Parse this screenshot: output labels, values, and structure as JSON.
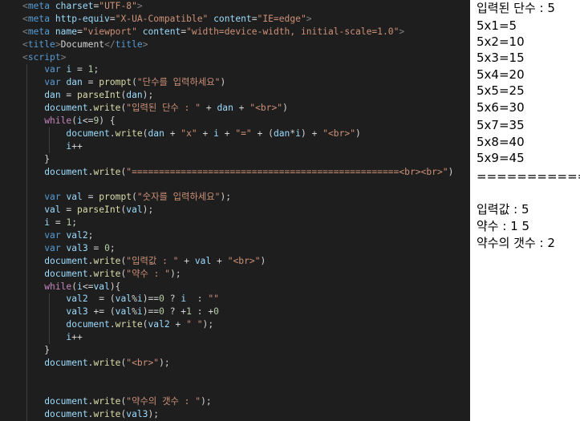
{
  "editor": {
    "theme": {
      "background": "#1e1e1e",
      "tag": "#569cd6",
      "attr": "#9cdcfe",
      "string": "#ce9178",
      "keyword": "#569cd6",
      "control": "#c586c0",
      "function": "#dcdcaa",
      "number": "#b5cea8"
    },
    "lines": [
      [
        {
          "t": "<",
          "c": "punc"
        },
        {
          "t": "meta",
          "c": "tag"
        },
        {
          "t": " "
        },
        {
          "t": "charset",
          "c": "attr"
        },
        {
          "t": "="
        },
        {
          "t": "\"UTF-8\"",
          "c": "str"
        },
        {
          "t": ">",
          "c": "punc"
        }
      ],
      [
        {
          "t": "<",
          "c": "punc"
        },
        {
          "t": "meta",
          "c": "tag"
        },
        {
          "t": " "
        },
        {
          "t": "http-equiv",
          "c": "attr"
        },
        {
          "t": "="
        },
        {
          "t": "\"X-UA-Compatible\"",
          "c": "str"
        },
        {
          "t": " "
        },
        {
          "t": "content",
          "c": "attr"
        },
        {
          "t": "="
        },
        {
          "t": "\"IE=edge\"",
          "c": "str"
        },
        {
          "t": ">",
          "c": "punc"
        }
      ],
      [
        {
          "t": "<",
          "c": "punc"
        },
        {
          "t": "meta",
          "c": "tag"
        },
        {
          "t": " "
        },
        {
          "t": "name",
          "c": "attr"
        },
        {
          "t": "="
        },
        {
          "t": "\"viewport\"",
          "c": "str"
        },
        {
          "t": " "
        },
        {
          "t": "content",
          "c": "attr"
        },
        {
          "t": "="
        },
        {
          "t": "\"width=device-width, initial-scale=1.0\"",
          "c": "str"
        },
        {
          "t": ">",
          "c": "punc"
        }
      ],
      [
        {
          "t": "<",
          "c": "punc"
        },
        {
          "t": "title",
          "c": "tag"
        },
        {
          "t": ">",
          "c": "punc"
        },
        {
          "t": "Document",
          "c": "txt"
        },
        {
          "t": "</",
          "c": "punc"
        },
        {
          "t": "title",
          "c": "tag"
        },
        {
          "t": ">",
          "c": "punc"
        }
      ],
      [
        {
          "t": "<",
          "c": "punc"
        },
        {
          "t": "script",
          "c": "tag"
        },
        {
          "t": ">",
          "c": "punc"
        }
      ],
      [
        {
          "t": "    "
        },
        {
          "t": "var",
          "c": "kw"
        },
        {
          "t": " "
        },
        {
          "t": "i",
          "c": "var"
        },
        {
          "t": " = "
        },
        {
          "t": "1",
          "c": "num"
        },
        {
          "t": ";"
        }
      ],
      [
        {
          "t": "    "
        },
        {
          "t": "var",
          "c": "kw"
        },
        {
          "t": " "
        },
        {
          "t": "dan",
          "c": "var"
        },
        {
          "t": " = "
        },
        {
          "t": "prompt",
          "c": "fn"
        },
        {
          "t": "("
        },
        {
          "t": "\"단수를 입력하세요\"",
          "c": "str"
        },
        {
          "t": ")"
        }
      ],
      [
        {
          "t": "    "
        },
        {
          "t": "dan",
          "c": "var"
        },
        {
          "t": " = "
        },
        {
          "t": "parseInt",
          "c": "fn"
        },
        {
          "t": "("
        },
        {
          "t": "dan",
          "c": "var"
        },
        {
          "t": ");"
        }
      ],
      [
        {
          "t": "    "
        },
        {
          "t": "document",
          "c": "var"
        },
        {
          "t": "."
        },
        {
          "t": "write",
          "c": "fn"
        },
        {
          "t": "("
        },
        {
          "t": "\"입력된 단수 : \"",
          "c": "str"
        },
        {
          "t": " + "
        },
        {
          "t": "dan",
          "c": "var"
        },
        {
          "t": " + "
        },
        {
          "t": "\"<br>\"",
          "c": "str"
        },
        {
          "t": ")"
        }
      ],
      [
        {
          "t": "    "
        },
        {
          "t": "while",
          "c": "ctl"
        },
        {
          "t": "("
        },
        {
          "t": "i",
          "c": "var"
        },
        {
          "t": "<="
        },
        {
          "t": "9",
          "c": "num"
        },
        {
          "t": ") {"
        }
      ],
      [
        {
          "t": "        "
        },
        {
          "t": "document",
          "c": "var"
        },
        {
          "t": "."
        },
        {
          "t": "write",
          "c": "fn"
        },
        {
          "t": "("
        },
        {
          "t": "dan",
          "c": "var"
        },
        {
          "t": " + "
        },
        {
          "t": "\"x\"",
          "c": "str"
        },
        {
          "t": " + "
        },
        {
          "t": "i",
          "c": "var"
        },
        {
          "t": " + "
        },
        {
          "t": "\"=\"",
          "c": "str"
        },
        {
          "t": " + ("
        },
        {
          "t": "dan",
          "c": "var"
        },
        {
          "t": "*"
        },
        {
          "t": "i",
          "c": "var"
        },
        {
          "t": ") + "
        },
        {
          "t": "\"<br>\"",
          "c": "str"
        },
        {
          "t": ")"
        }
      ],
      [
        {
          "t": "        "
        },
        {
          "t": "i",
          "c": "var"
        },
        {
          "t": "++"
        }
      ],
      [
        {
          "t": "    }"
        }
      ],
      [
        {
          "t": "    "
        },
        {
          "t": "document",
          "c": "var"
        },
        {
          "t": "."
        },
        {
          "t": "write",
          "c": "fn"
        },
        {
          "t": "("
        },
        {
          "t": "\"=================================================<br><br>\"",
          "c": "str"
        },
        {
          "t": ")"
        }
      ],
      [],
      [
        {
          "t": "    "
        },
        {
          "t": "var",
          "c": "kw"
        },
        {
          "t": " "
        },
        {
          "t": "val",
          "c": "var"
        },
        {
          "t": " = "
        },
        {
          "t": "prompt",
          "c": "fn"
        },
        {
          "t": "("
        },
        {
          "t": "\"숫자를 입력하세요\"",
          "c": "str"
        },
        {
          "t": ");"
        }
      ],
      [
        {
          "t": "    "
        },
        {
          "t": "val",
          "c": "var"
        },
        {
          "t": " = "
        },
        {
          "t": "parseInt",
          "c": "fn"
        },
        {
          "t": "("
        },
        {
          "t": "val",
          "c": "var"
        },
        {
          "t": ");"
        }
      ],
      [
        {
          "t": "    "
        },
        {
          "t": "i",
          "c": "var"
        },
        {
          "t": " = "
        },
        {
          "t": "1",
          "c": "num"
        },
        {
          "t": ";"
        }
      ],
      [
        {
          "t": "    "
        },
        {
          "t": "var",
          "c": "kw"
        },
        {
          "t": " "
        },
        {
          "t": "val2",
          "c": "var"
        },
        {
          "t": ";"
        }
      ],
      [
        {
          "t": "    "
        },
        {
          "t": "var",
          "c": "kw"
        },
        {
          "t": " "
        },
        {
          "t": "val3",
          "c": "var"
        },
        {
          "t": " = "
        },
        {
          "t": "0",
          "c": "num"
        },
        {
          "t": ";"
        }
      ],
      [
        {
          "t": "    "
        },
        {
          "t": "document",
          "c": "var"
        },
        {
          "t": "."
        },
        {
          "t": "write",
          "c": "fn"
        },
        {
          "t": "("
        },
        {
          "t": "\"입력값 : \"",
          "c": "str"
        },
        {
          "t": " + "
        },
        {
          "t": "val",
          "c": "var"
        },
        {
          "t": " + "
        },
        {
          "t": "\"<br>\"",
          "c": "str"
        },
        {
          "t": ")"
        }
      ],
      [
        {
          "t": "    "
        },
        {
          "t": "document",
          "c": "var"
        },
        {
          "t": "."
        },
        {
          "t": "write",
          "c": "fn"
        },
        {
          "t": "("
        },
        {
          "t": "\"약수 : \"",
          "c": "str"
        },
        {
          "t": ");"
        }
      ],
      [
        {
          "t": "    "
        },
        {
          "t": "while",
          "c": "ctl"
        },
        {
          "t": "("
        },
        {
          "t": "i",
          "c": "var"
        },
        {
          "t": "<="
        },
        {
          "t": "val",
          "c": "var"
        },
        {
          "t": "){"
        }
      ],
      [
        {
          "t": "        "
        },
        {
          "t": "val2",
          "c": "var"
        },
        {
          "t": "  = ("
        },
        {
          "t": "val",
          "c": "var"
        },
        {
          "t": "%"
        },
        {
          "t": "i",
          "c": "var"
        },
        {
          "t": ")=="
        },
        {
          "t": "0",
          "c": "num"
        },
        {
          "t": " ? "
        },
        {
          "t": "i",
          "c": "var"
        },
        {
          "t": "  : "
        },
        {
          "t": "\"\"",
          "c": "str"
        }
      ],
      [
        {
          "t": "        "
        },
        {
          "t": "val3",
          "c": "var"
        },
        {
          "t": " += ("
        },
        {
          "t": "val",
          "c": "var"
        },
        {
          "t": "%"
        },
        {
          "t": "i",
          "c": "var"
        },
        {
          "t": ")=="
        },
        {
          "t": "0",
          "c": "num"
        },
        {
          "t": " ? +"
        },
        {
          "t": "1",
          "c": "num"
        },
        {
          "t": " : +"
        },
        {
          "t": "0",
          "c": "num"
        }
      ],
      [
        {
          "t": "        "
        },
        {
          "t": "document",
          "c": "var"
        },
        {
          "t": "."
        },
        {
          "t": "write",
          "c": "fn"
        },
        {
          "t": "("
        },
        {
          "t": "val2",
          "c": "var"
        },
        {
          "t": " + "
        },
        {
          "t": "\" \"",
          "c": "str"
        },
        {
          "t": ");"
        }
      ],
      [
        {
          "t": "        "
        },
        {
          "t": "i",
          "c": "var"
        },
        {
          "t": "++"
        }
      ],
      [
        {
          "t": "    }"
        }
      ],
      [
        {
          "t": "    "
        },
        {
          "t": "document",
          "c": "var"
        },
        {
          "t": "."
        },
        {
          "t": "write",
          "c": "fn"
        },
        {
          "t": "("
        },
        {
          "t": "\"<br>\"",
          "c": "str"
        },
        {
          "t": ");"
        }
      ],
      [],
      [],
      [
        {
          "t": "    "
        },
        {
          "t": "document",
          "c": "var"
        },
        {
          "t": "."
        },
        {
          "t": "write",
          "c": "fn"
        },
        {
          "t": "("
        },
        {
          "t": "\"약수의 갯수 : \"",
          "c": "str"
        },
        {
          "t": ");"
        }
      ],
      [
        {
          "t": "    "
        },
        {
          "t": "document",
          "c": "var"
        },
        {
          "t": "."
        },
        {
          "t": "write",
          "c": "fn"
        },
        {
          "t": "("
        },
        {
          "t": "val3",
          "c": "var"
        },
        {
          "t": ");"
        }
      ]
    ]
  },
  "preview": {
    "lines": [
      "입력된 단수 : 5",
      "5x1=5",
      "5x2=10",
      "5x3=15",
      "5x4=20",
      "5x5=25",
      "5x6=30",
      "5x7=35",
      "5x8=40",
      "5x9=45",
      "=================================================",
      "",
      "입력값 : 5",
      "약수 : 1 5",
      "약수의 갯수 : 2"
    ]
  }
}
